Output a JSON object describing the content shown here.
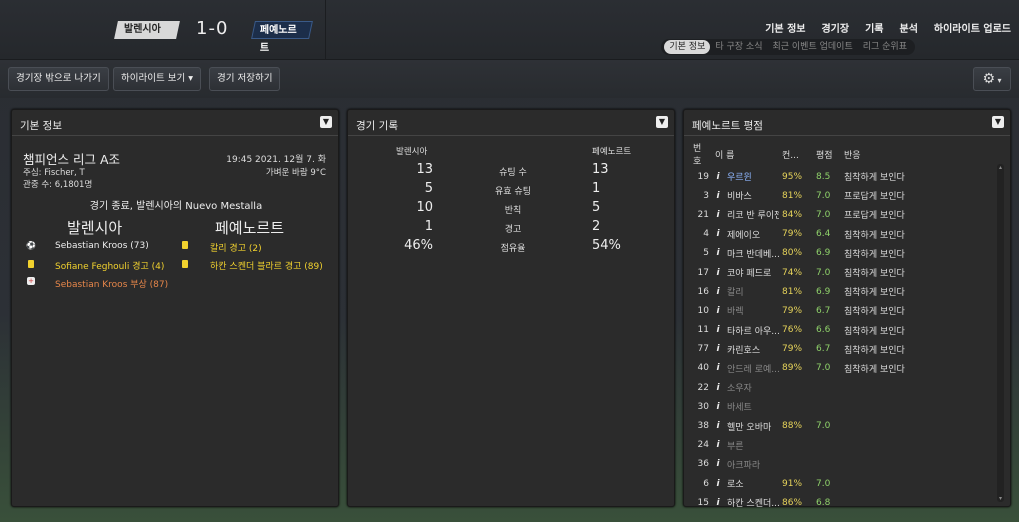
{
  "match": {
    "home": "발렌시아",
    "away": "페예노르트",
    "score": "1-0"
  },
  "topnav": [
    "기본 정보",
    "경기장",
    "기록",
    "분석",
    "하이라이트 업로드"
  ],
  "subtabs": [
    "기본 정보",
    "타 구장 소식",
    "최근 이벤트 업데이트",
    "리그 순위표"
  ],
  "toolbar": {
    "leave": "경기장 밖으로 나가기",
    "highlights": "하이라이트 보기",
    "save": "경기 저장하기"
  },
  "info": {
    "title": "기본 정보",
    "competition": "챔피언스 리그 A조",
    "datetime": "19:45 2021. 12월 7. 화",
    "referee": "주심: Fischer, T",
    "weather": "가벼운 바람 9°C",
    "attendance": "관중 수: 6,1801명",
    "summary": "경기 종료, 발렌시아의 Nuevo Mestalla",
    "home": "발렌시아",
    "away": "페예노르트",
    "home_events": [
      "Sebastian Kroos (73)",
      "Sofiane Feghouli 경고 (4)",
      "Sebastian Kroos 부상 (87)"
    ],
    "away_events": [
      "칼리 경고 (2)",
      "하칸 스켄더 블라르 경고 (89)"
    ]
  },
  "stats": {
    "title": "경기 기록",
    "home": "발렌시아",
    "away": "페예노르트",
    "rows": [
      {
        "label": "슈팅 수",
        "home": "13",
        "away": "13"
      },
      {
        "label": "유효 슈팅",
        "home": "5",
        "away": "1"
      },
      {
        "label": "반칙",
        "home": "10",
        "away": "5"
      },
      {
        "label": "경고",
        "home": "1",
        "away": "2"
      },
      {
        "label": "점유율",
        "home": "46%",
        "away": "54%"
      }
    ]
  },
  "ratings": {
    "title": "페예노르트 평점",
    "headers": [
      "번호",
      "이 름",
      "컨...",
      "평점",
      "반응"
    ],
    "rows": [
      {
        "no": "19",
        "name": "우르윈",
        "pct": "95%",
        "rt": "8.5",
        "react": "침착하게 보인다",
        "style": "hl"
      },
      {
        "no": "3",
        "name": "비바스",
        "pct": "81%",
        "rt": "7.0",
        "react": "프로답게 보인다",
        "style": ""
      },
      {
        "no": "21",
        "name": "리코 반 루이젠",
        "pct": "84%",
        "rt": "7.0",
        "react": "프로답게 보인다",
        "style": ""
      },
      {
        "no": "4",
        "name": "제에이오",
        "pct": "79%",
        "rt": "6.4",
        "react": "침착하게 보인다",
        "style": ""
      },
      {
        "no": "5",
        "name": "마크 반데베...",
        "pct": "80%",
        "rt": "6.9",
        "react": "침착하게 보인다",
        "style": ""
      },
      {
        "no": "17",
        "name": "코야 페드로",
        "pct": "74%",
        "rt": "7.0",
        "react": "침착하게 보인다",
        "style": ""
      },
      {
        "no": "16",
        "name": "칼리",
        "pct": "81%",
        "rt": "6.9",
        "react": "침착하게 보인다",
        "style": "dim"
      },
      {
        "no": "10",
        "name": "바렉",
        "pct": "79%",
        "rt": "6.7",
        "react": "침착하게 보인다",
        "style": "dim"
      },
      {
        "no": "11",
        "name": "타하르 아우...",
        "pct": "76%",
        "rt": "6.6",
        "react": "침착하게 보인다",
        "style": ""
      },
      {
        "no": "77",
        "name": "카린호스",
        "pct": "79%",
        "rt": "6.7",
        "react": "침착하게 보인다",
        "style": ""
      },
      {
        "no": "40",
        "name": "안드레 로예...",
        "pct": "89%",
        "rt": "7.0",
        "react": "침착하게 보인다",
        "style": "dim"
      },
      {
        "no": "22",
        "name": "소우자",
        "pct": "",
        "rt": "",
        "react": "",
        "style": "dim"
      },
      {
        "no": "30",
        "name": "바세트",
        "pct": "",
        "rt": "",
        "react": "",
        "style": "dim"
      },
      {
        "no": "38",
        "name": "헬만 오바마",
        "pct": "88%",
        "rt": "7.0",
        "react": "",
        "style": ""
      },
      {
        "no": "24",
        "name": "부른",
        "pct": "",
        "rt": "",
        "react": "",
        "style": "dim"
      },
      {
        "no": "36",
        "name": "아크파라",
        "pct": "",
        "rt": "",
        "react": "",
        "style": "dim"
      },
      {
        "no": "6",
        "name": "로소",
        "pct": "91%",
        "rt": "7.0",
        "react": "",
        "style": ""
      },
      {
        "no": "15",
        "name": "하칸 스켄더...",
        "pct": "86%",
        "rt": "6.8",
        "react": "",
        "style": ""
      }
    ]
  }
}
